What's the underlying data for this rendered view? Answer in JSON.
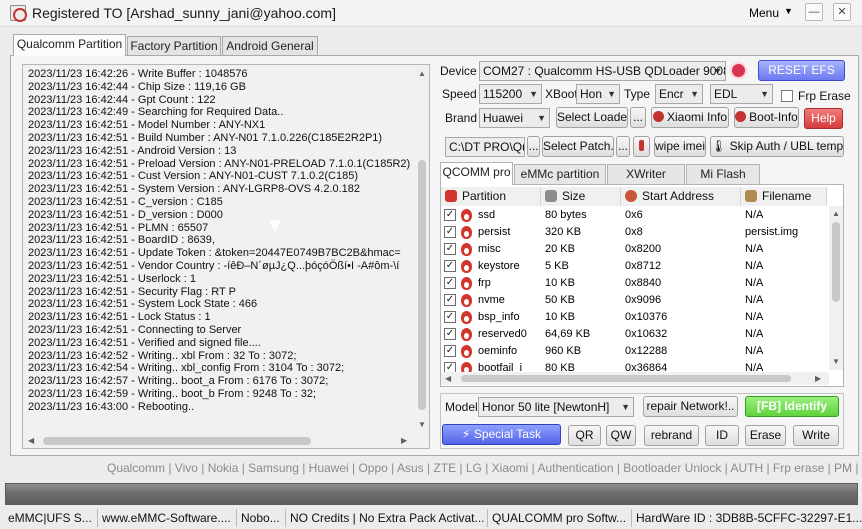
{
  "window": {
    "title": "Registered TO [Arshad_sunny_jani@yahoo.com]",
    "menu_label": "Menu",
    "minimize": "—",
    "close": "✕"
  },
  "tabs": [
    "Qualcomm Partition",
    "Factory Partition",
    "Android General"
  ],
  "log": [
    "2023/11/23 16:42:26 - Write Buffer : 1048576",
    "2023/11/23 16:42:44 - Chip Size : 119,16 GB",
    "2023/11/23 16:42:44 - Gpt Count : 122",
    "2023/11/23 16:42:49 - Searching for Required Data..",
    "2023/11/23 16:42:51 - Model Number : ANY-NX1",
    "2023/11/23 16:42:51 - Build Number : ANY-N01 7.1.0.226(C185E2R2P1)",
    "2023/11/23 16:42:51 - Android Version : 13",
    "2023/11/23 16:42:51 - Preload Version : ANY-N01-PRELOAD 7.1.0.1(C185R2)",
    "2023/11/23 16:42:51 - Cust Version : ANY-N01-CUST 7.1.0.2(C185)",
    "2023/11/23 16:42:51 - System Version : ANY-LGRP8-OVS 4.2.0.182",
    "2023/11/23 16:42:51 - C_version : C185",
    "2023/11/23 16:42:51 - D_version : D000",
    "2023/11/23 16:42:51 - PLMN : 65507",
    "2023/11/23 16:42:51 - BoardID : 8639,",
    "2023/11/23 16:42:51 - Update Token : &token=20447E0749B7BC2B&hmac=",
    "2023/11/23 16:42:51 - Vendor Country : -íêÐ–N´øµJ¿Q...þóçóÖßí•I   -A#ôm-\\í",
    "2023/11/23 16:42:51 - Userlock : 1",
    "2023/11/23 16:42:51 - Security Flag : RT P",
    "2023/11/23 16:42:51 - System Lock State : 466",
    "2023/11/23 16:42:51 - Lock Status : 1",
    "2023/11/23 16:42:51 - Connecting to Server",
    "2023/11/23 16:42:51 - Verified and signed file....",
    "2023/11/23 16:42:52 - Writing.. xbl From : 32 To : 3072;",
    "2023/11/23 16:42:54 - Writing.. xbl_config From : 3104 To : 3072;",
    "2023/11/23 16:42:57 - Writing.. boot_a From : 6176 To : 3072;",
    "2023/11/23 16:42:59 - Writing.. boot_b From : 9248 To : 32;",
    "2023/11/23 16:43:00 - Rebooting.."
  ],
  "device": {
    "label": "Device",
    "value": "COM27 : Qualcomm HS-USB QDLoader 9008",
    "reset_efs": "RESET EFS"
  },
  "speed": {
    "label": "Speed",
    "value": "115200",
    "xboot_label": "XBoot",
    "xboot_value": "Hon",
    "type_label": "Type",
    "type_value": "Encr",
    "mode_value": "EDL",
    "frp_erase": "Frp Erase"
  },
  "brand": {
    "label": "Brand",
    "value": "Huawei",
    "select_loader": "Select Loader",
    "dots": "...",
    "xiaomi_info": "Xiaomi Info",
    "boot_info": "Boot-Info",
    "help": "Help"
  },
  "path_row": {
    "path_value": "C:\\DT PRO\\Qual",
    "dots": "...",
    "select_patch": "Select Patch..",
    "wipe_imei": "wipe imei",
    "skip_auth": "Skip Auth / UBL temp"
  },
  "sub_tabs": [
    "QCOMM pro",
    "eMMc partition",
    "XWriter",
    "Mi Flash"
  ],
  "table": {
    "headers": [
      "Partition",
      "Size",
      "Start Address",
      "Filename"
    ],
    "rows": [
      {
        "partition": "ssd",
        "size": "80 bytes",
        "start": "0x6",
        "file": "N/A"
      },
      {
        "partition": "persist",
        "size": "320 KB",
        "start": "0x8",
        "file": "persist.img"
      },
      {
        "partition": "misc",
        "size": "20 KB",
        "start": "0x8200",
        "file": "N/A"
      },
      {
        "partition": "keystore",
        "size": "5 KB",
        "start": "0x8712",
        "file": "N/A"
      },
      {
        "partition": "frp",
        "size": "10 KB",
        "start": "0x8840",
        "file": "N/A"
      },
      {
        "partition": "nvme",
        "size": "50 KB",
        "start": "0x9096",
        "file": "N/A"
      },
      {
        "partition": "bsp_info",
        "size": "10 KB",
        "start": "0x10376",
        "file": "N/A"
      },
      {
        "partition": "reserved0",
        "size": "64,69 KB",
        "start": "0x10632",
        "file": "N/A"
      },
      {
        "partition": "oeminfo",
        "size": "960 KB",
        "start": "0x12288",
        "file": "N/A"
      },
      {
        "partition": "bootfail_i",
        "size": "80 KB",
        "start": "0x36864",
        "file": "N/A"
      }
    ],
    "check_mark": "✓"
  },
  "model": {
    "label": "Model",
    "value": "Honor 50 lite [NewtonH]",
    "repair_network": "repair Network!..",
    "fb_identify": "[FB] Identify"
  },
  "actions": {
    "special_task": "Special Task",
    "qr": "QR",
    "qw": "QW",
    "rebrand": "rebrand",
    "id": "ID",
    "erase": "Erase",
    "write": "Write"
  },
  "marquee": "Qualcomm | Vivo | Nokia | Samsung | Huawei | Oppo | Asus | ZTE | LG | Xiaomi | Authentication | Bootloader Unlock | AUTH | Frp erase | PM | repair D",
  "status": [
    "eMMC|UFS S...",
    "www.eMMC-Software....",
    "Nobo...",
    "NO Credits | No Extra Pack Activat...",
    "QUALCOMM pro Softw...",
    "HardWare ID : 3DB8B-5CFFC-32297-E1..."
  ],
  "colors": {
    "accent_blue": "#6d79f0",
    "help_red": "#d63d3d",
    "identify_green": "#5fd33d",
    "flame_red": "#d2352b"
  }
}
